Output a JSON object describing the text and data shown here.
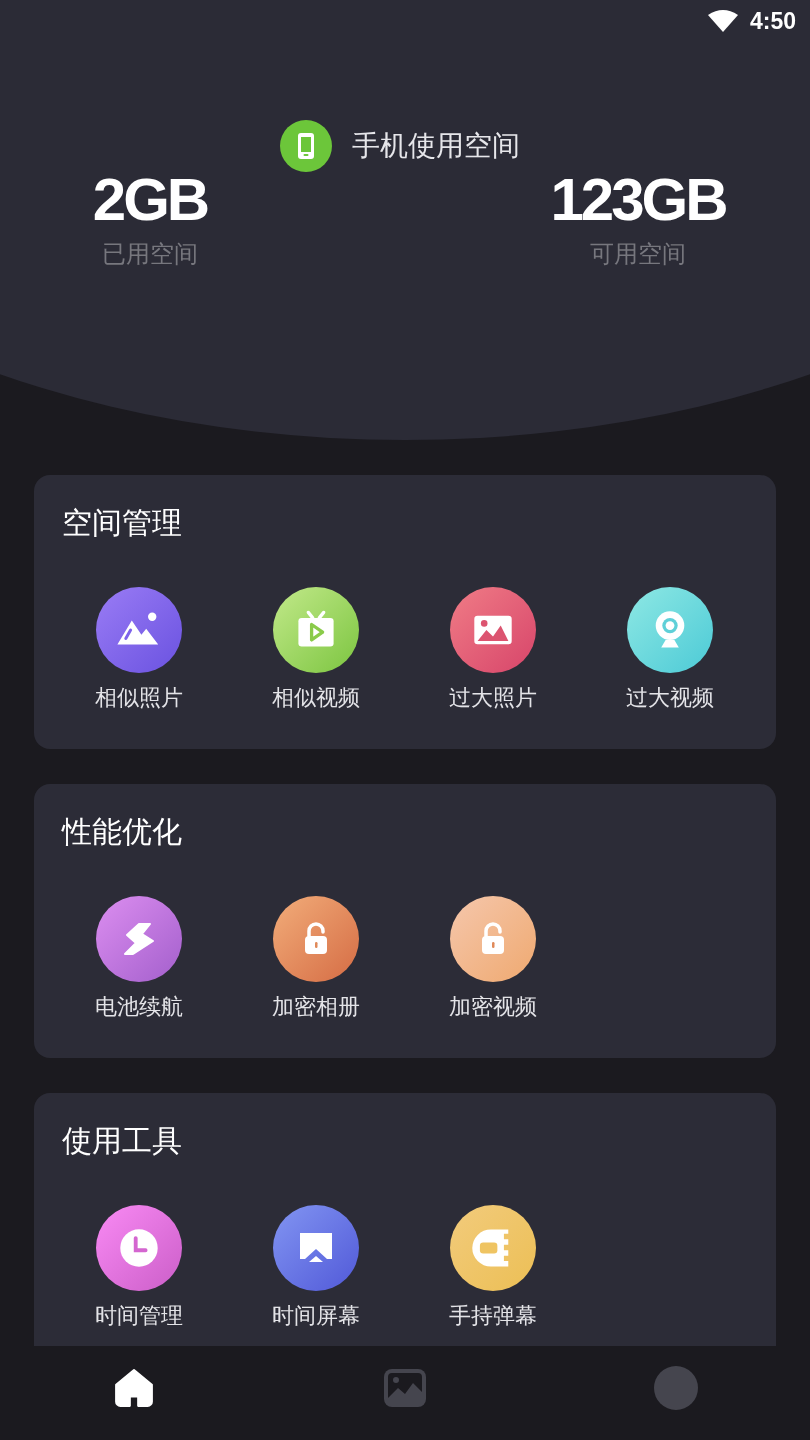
{
  "status_bar": {
    "time": "4:50"
  },
  "storage": {
    "title": "手机使用空间",
    "used": {
      "value": "2GB",
      "label": "已用空间"
    },
    "free": {
      "value": "123GB",
      "label": "可用空间"
    }
  },
  "sections": [
    {
      "title": "空间管理",
      "items": [
        {
          "label": "相似照片",
          "kind": "mountain"
        },
        {
          "label": "相似视频",
          "kind": "tv"
        },
        {
          "label": "过大照片",
          "kind": "photo"
        },
        {
          "label": "过大视频",
          "kind": "webcam"
        }
      ]
    },
    {
      "title": "性能优化",
      "items": [
        {
          "label": "电池续航",
          "kind": "bolt"
        },
        {
          "label": "加密相册",
          "kind": "lock"
        },
        {
          "label": "加密视频",
          "kind": "lock2"
        }
      ]
    },
    {
      "title": "使用工具",
      "items": [
        {
          "label": "时间管理",
          "kind": "clock"
        },
        {
          "label": "时间屏幕",
          "kind": "cast"
        },
        {
          "label": "手持弹幕",
          "kind": "danmu"
        }
      ]
    }
  ],
  "nav": [
    {
      "kind": "home",
      "selected": true
    },
    {
      "kind": "gallery",
      "selected": false
    },
    {
      "kind": "profile",
      "selected": false
    }
  ]
}
